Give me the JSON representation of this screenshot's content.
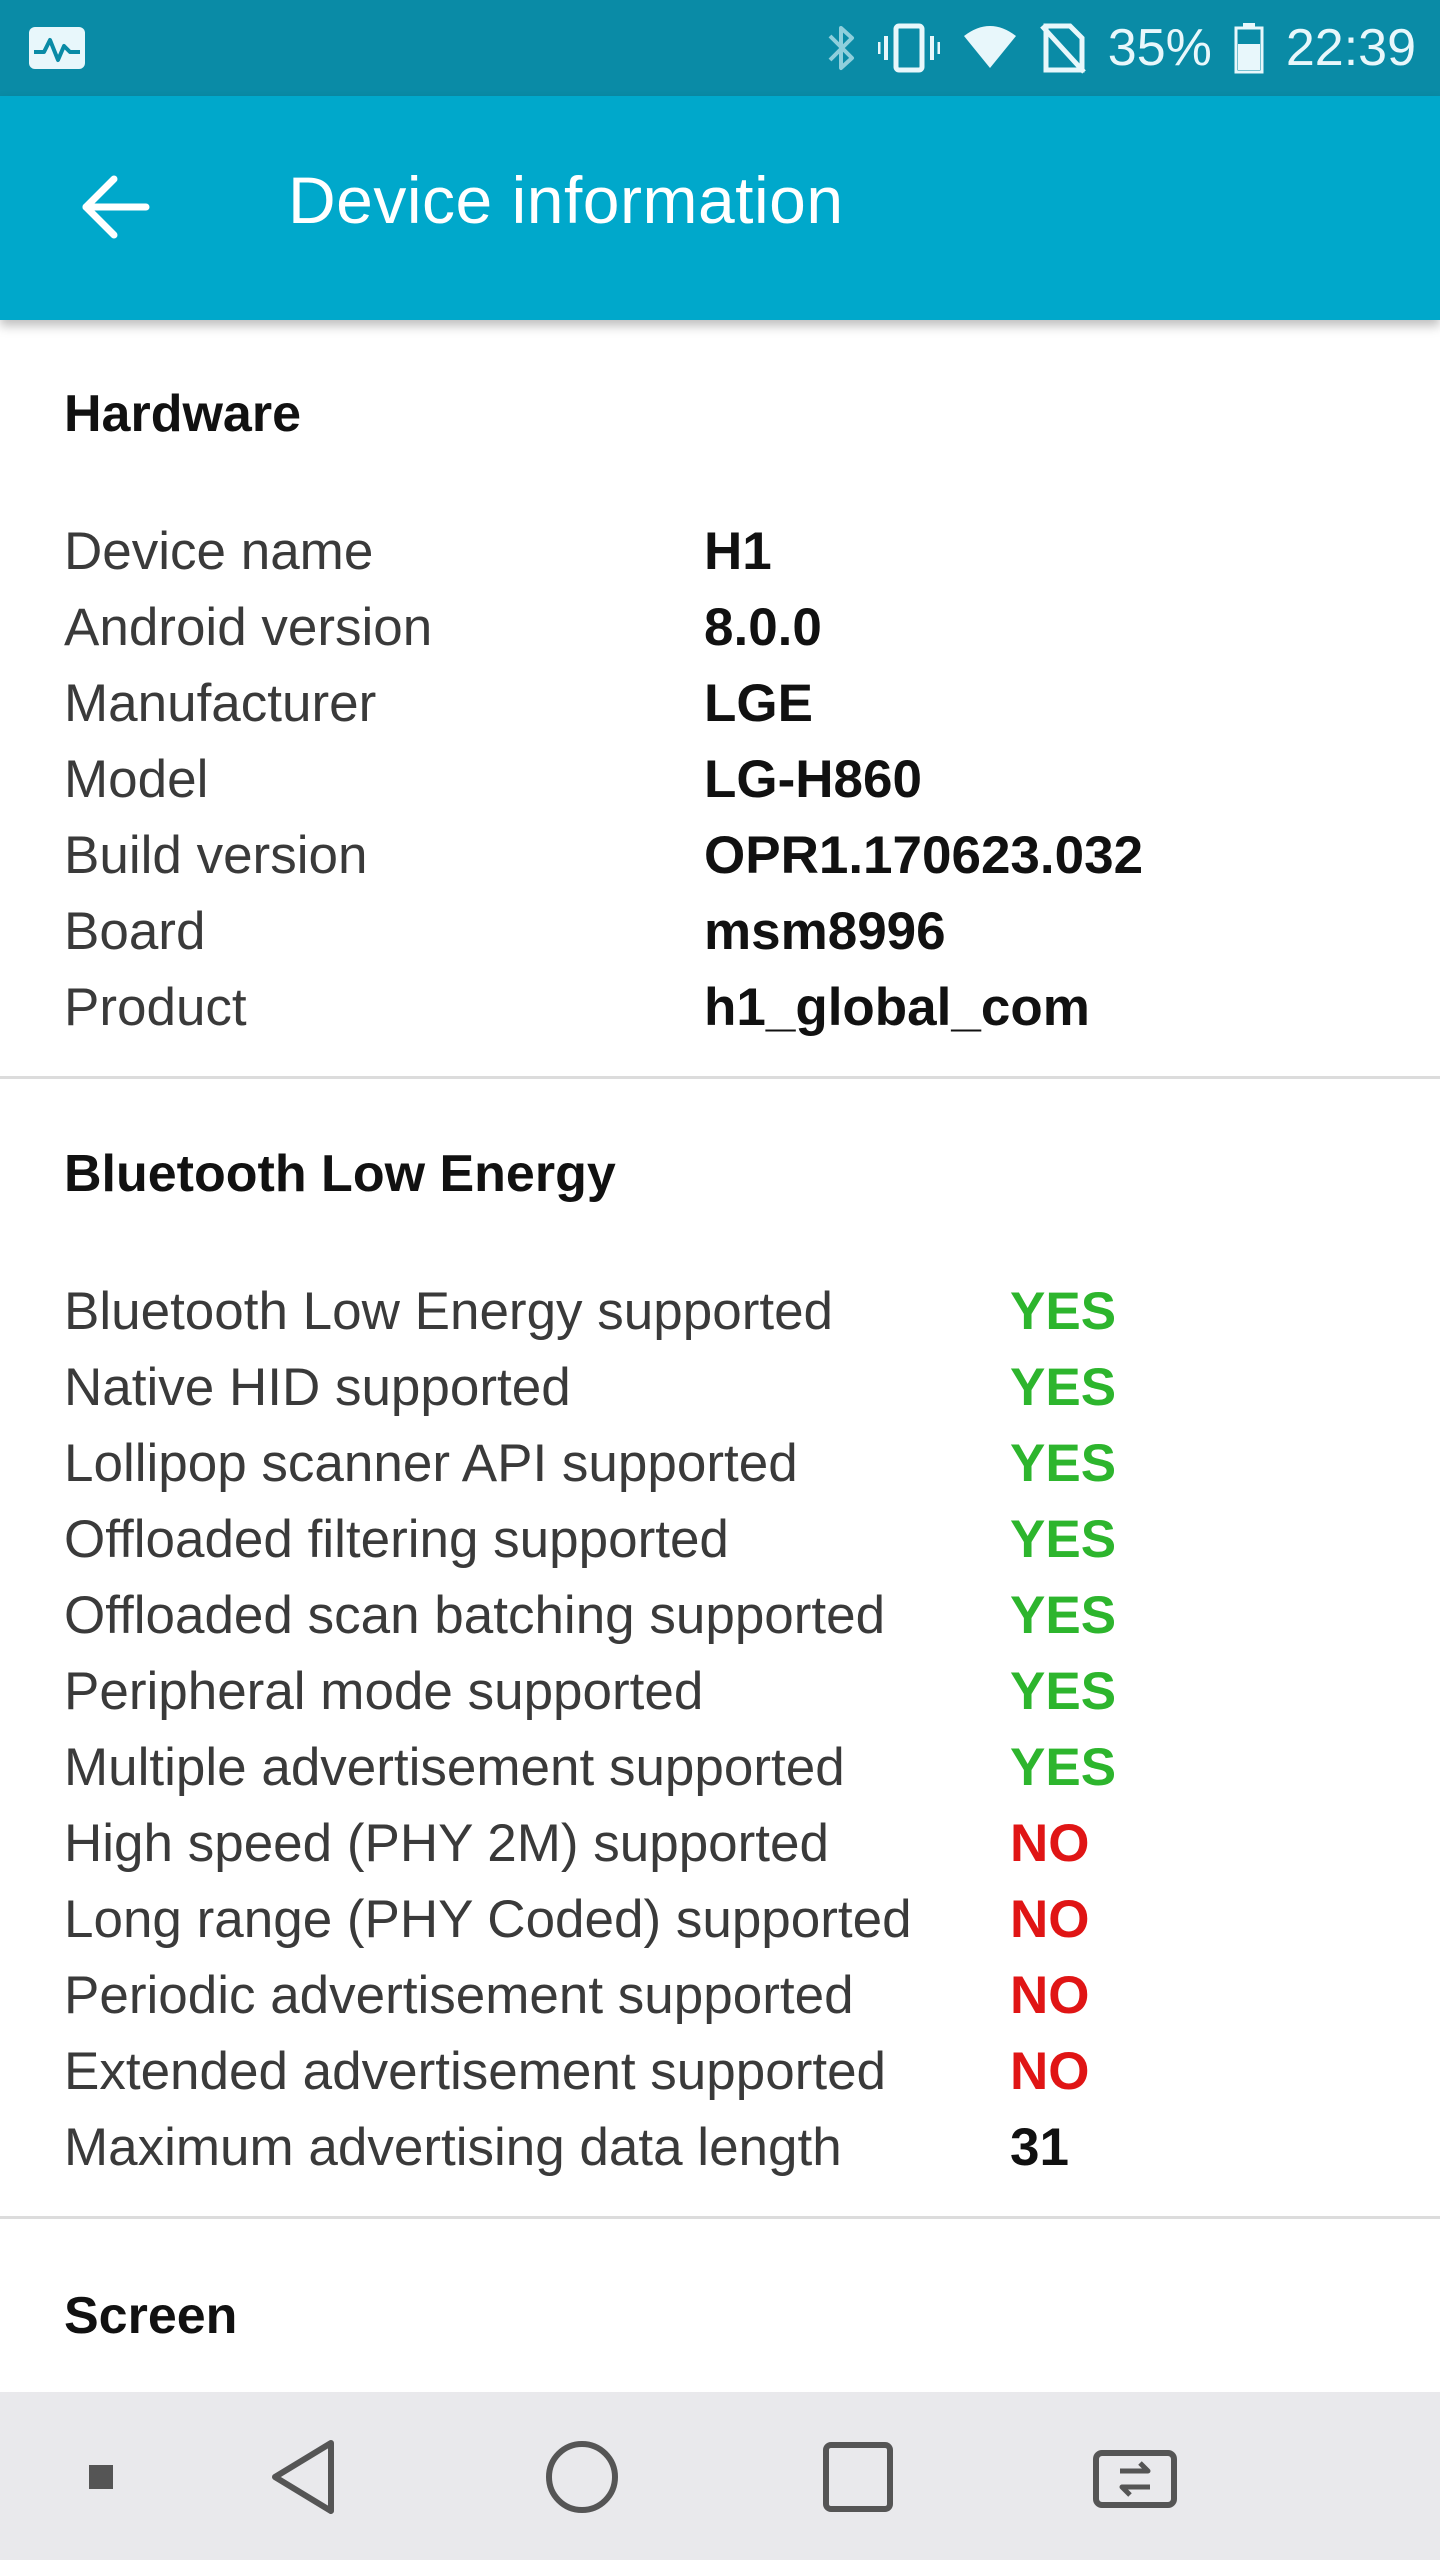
{
  "status_bar": {
    "battery_percent": "35%",
    "time": "22:39",
    "icons": [
      "activity-monitor-icon",
      "bluetooth-icon",
      "vibrate-icon",
      "wifi-icon",
      "no-sim-icon",
      "battery-icon"
    ]
  },
  "app_bar": {
    "title": "Device information",
    "back_icon": "arrow-left-icon"
  },
  "hardware": {
    "title": "Hardware",
    "rows": [
      {
        "label": "Device name",
        "value": "H1"
      },
      {
        "label": "Android version",
        "value": "8.0.0"
      },
      {
        "label": "Manufacturer",
        "value": "LGE"
      },
      {
        "label": "Model",
        "value": "LG-H860"
      },
      {
        "label": "Build version",
        "value": "OPR1.170623.032"
      },
      {
        "label": "Board",
        "value": "msm8996"
      },
      {
        "label": "Product",
        "value": "h1_global_com"
      }
    ]
  },
  "ble": {
    "title": "Bluetooth Low Energy",
    "rows": [
      {
        "label": "Bluetooth Low Energy supported",
        "value": "YES",
        "status": "yes"
      },
      {
        "label": "Native HID supported",
        "value": "YES",
        "status": "yes"
      },
      {
        "label": "Lollipop scanner API supported",
        "value": "YES",
        "status": "yes"
      },
      {
        "label": "Offloaded filtering supported",
        "value": "YES",
        "status": "yes"
      },
      {
        "label": "Offloaded scan batching supported",
        "value": "YES",
        "status": "yes"
      },
      {
        "label": "Peripheral mode supported",
        "value": "YES",
        "status": "yes"
      },
      {
        "label": "Multiple advertisement supported",
        "value": "YES",
        "status": "yes"
      },
      {
        "label": "High speed (PHY 2M) supported",
        "value": "NO",
        "status": "no"
      },
      {
        "label": "Long range (PHY Coded) supported",
        "value": "NO",
        "status": "no"
      },
      {
        "label": "Periodic advertisement supported",
        "value": "NO",
        "status": "no"
      },
      {
        "label": "Extended advertisement supported",
        "value": "NO",
        "status": "no"
      },
      {
        "label": "Maximum advertising data length",
        "value": "31",
        "status": "neutral"
      }
    ]
  },
  "screen": {
    "title": "Screen"
  },
  "colors": {
    "status_bar": "#0a8ba6",
    "app_bar": "#00a8cb",
    "yes": "#2db52d",
    "no": "#e01515"
  },
  "nav_bar": {
    "icons": [
      "small-square-icon",
      "back-triangle-icon",
      "home-circle-icon",
      "recents-square-icon",
      "dual-window-icon"
    ]
  }
}
